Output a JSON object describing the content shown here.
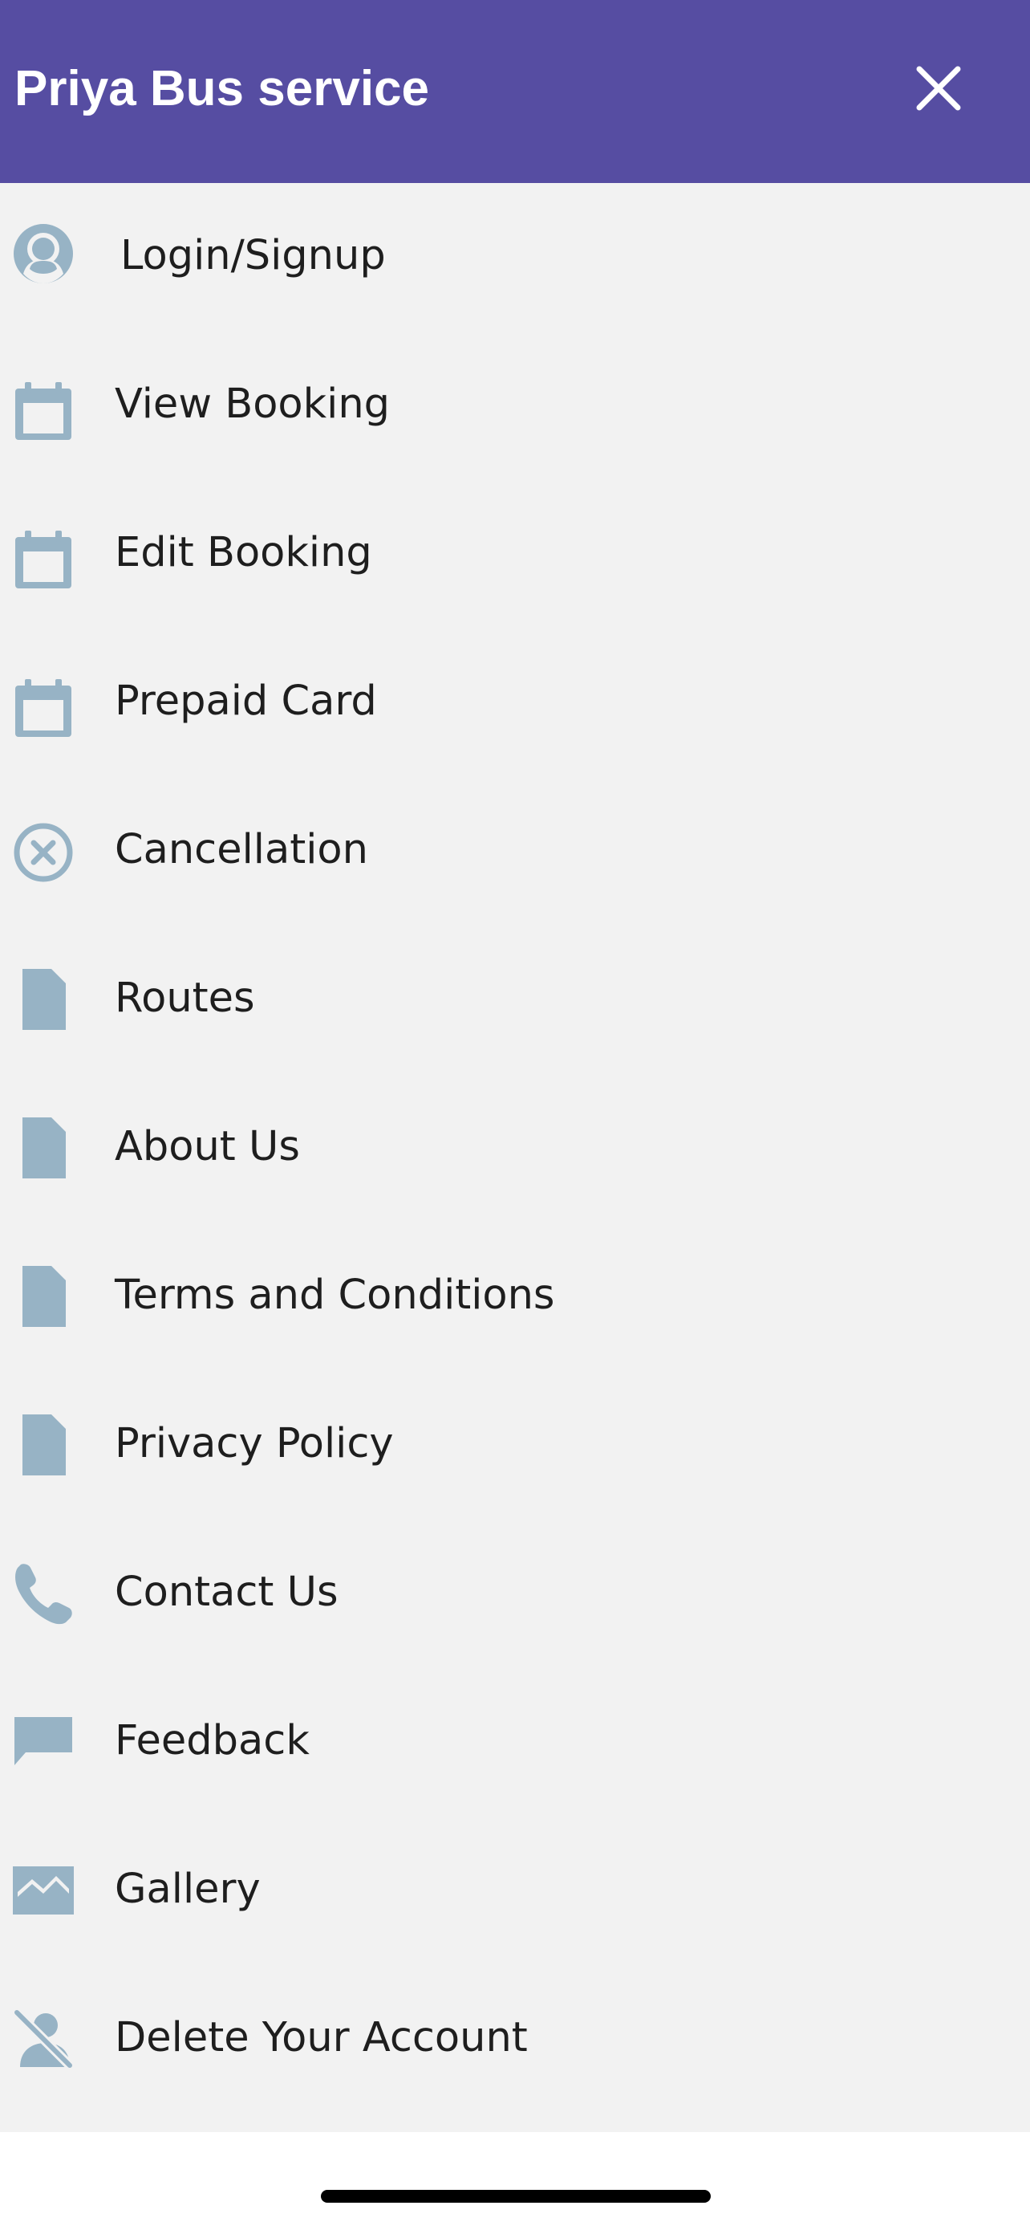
{
  "app": {
    "title": "Priya Bus service",
    "close_icon": "close-icon"
  },
  "colors": {
    "header_bg": "#564da2",
    "menu_bg": "#f2f2f2",
    "icon_color": "#97b3c5",
    "text_color": "#1e1e1e"
  },
  "menu": {
    "items": [
      {
        "label": "Login/Signup",
        "icon": "user-circle-icon"
      },
      {
        "label": "View Booking",
        "icon": "calendar-icon"
      },
      {
        "label": "Edit Booking",
        "icon": "calendar-icon"
      },
      {
        "label": "Prepaid Card",
        "icon": "calendar-icon"
      },
      {
        "label": "Cancellation",
        "icon": "cancel-circle-icon"
      },
      {
        "label": "Routes",
        "icon": "document-icon"
      },
      {
        "label": "About Us",
        "icon": "document-icon"
      },
      {
        "label": "Terms and Conditions",
        "icon": "document-icon"
      },
      {
        "label": "Privacy Policy",
        "icon": "document-icon"
      },
      {
        "label": "Contact Us",
        "icon": "phone-icon"
      },
      {
        "label": "Feedback",
        "icon": "chat-bubble-icon"
      },
      {
        "label": "Gallery",
        "icon": "image-icon"
      },
      {
        "label": "Delete Your Account",
        "icon": "user-off-icon"
      }
    ]
  }
}
